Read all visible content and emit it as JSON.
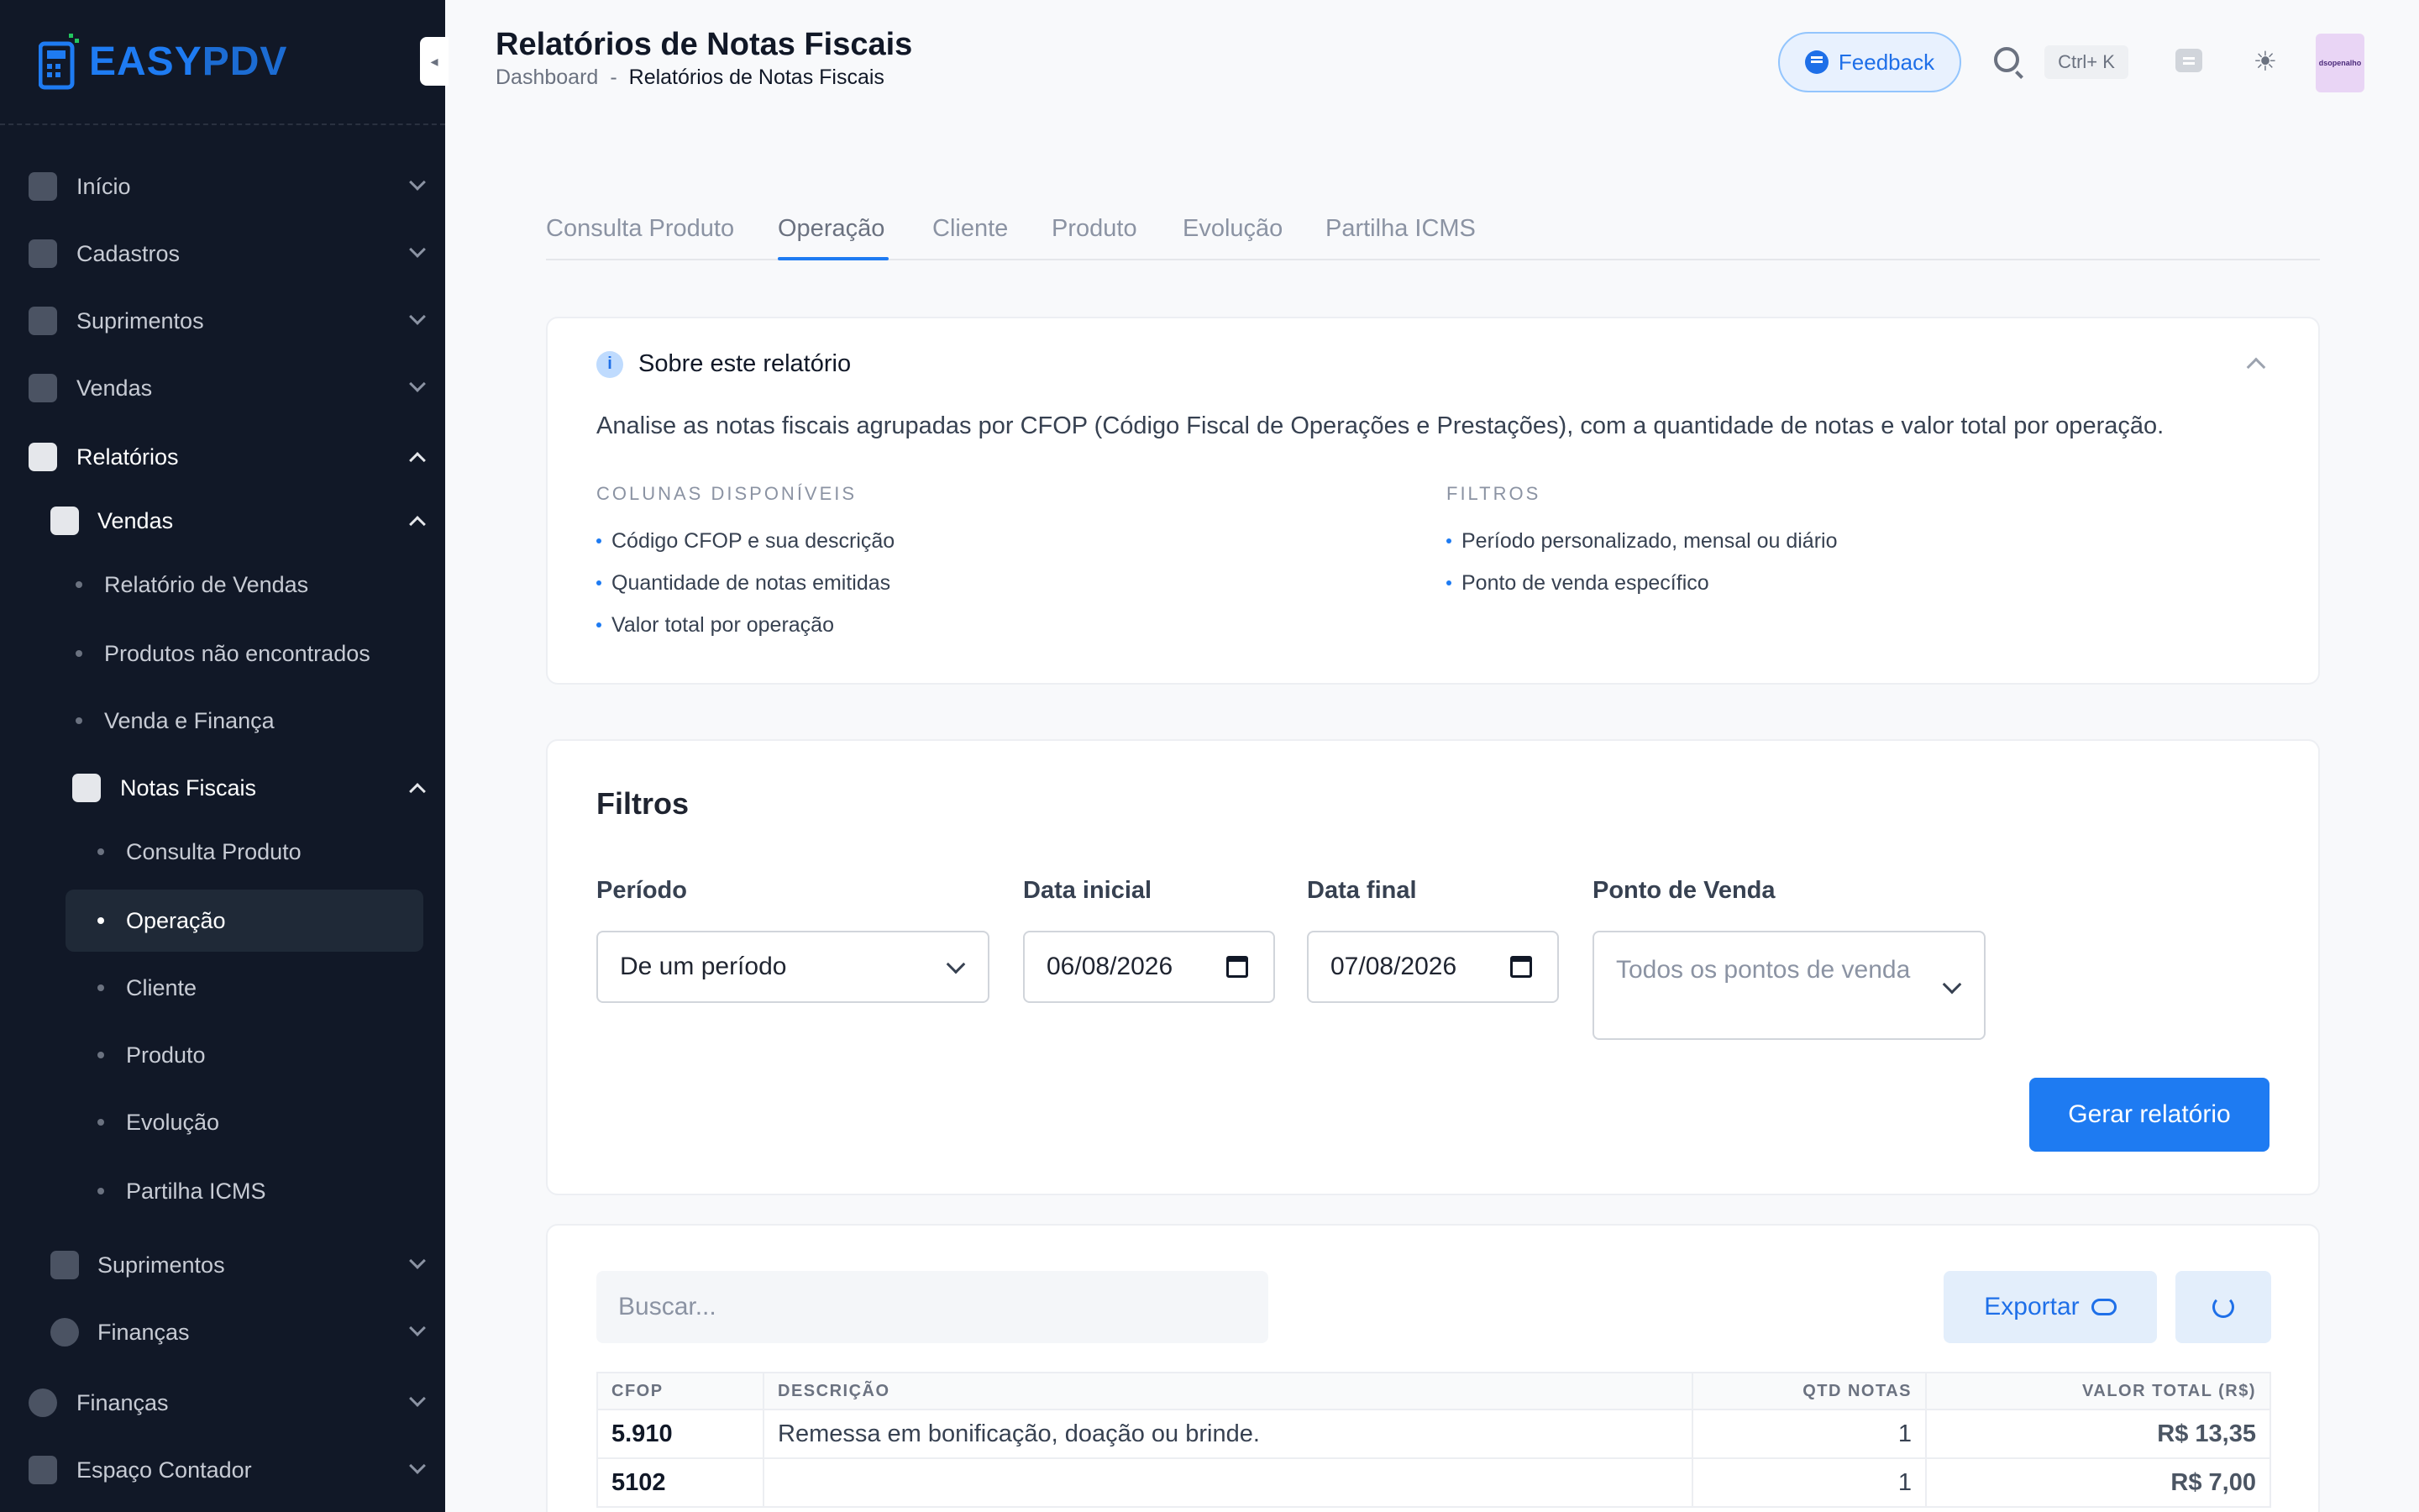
{
  "sidebar": {
    "logo": {
      "easy": "EASY",
      "pdv": "PDV"
    },
    "items": [
      {
        "label": "Início"
      },
      {
        "label": "Cadastros"
      },
      {
        "label": "Suprimentos"
      },
      {
        "label": "Vendas"
      },
      {
        "label": "Relatórios"
      },
      {
        "label": "Vendas"
      },
      {
        "label": "Relatório de Vendas"
      },
      {
        "label": "Produtos não encontrados"
      },
      {
        "label": "Venda e Finança"
      },
      {
        "label": "Notas Fiscais"
      },
      {
        "label": "Consulta Produto"
      },
      {
        "label": "Operação"
      },
      {
        "label": "Cliente"
      },
      {
        "label": "Produto"
      },
      {
        "label": "Evolução"
      },
      {
        "label": "Partilha ICMS"
      },
      {
        "label": "Suprimentos"
      },
      {
        "label": "Finanças"
      },
      {
        "label": "Finanças"
      },
      {
        "label": "Espaço Contador"
      }
    ]
  },
  "header": {
    "title": "Relatórios de Notas Fiscais",
    "breadcrumb": {
      "root": "Dashboard",
      "separator": "-",
      "current": "Relatórios de Notas Fiscais"
    },
    "feedback_label": "Feedback",
    "shortcut": "Ctrl+ K",
    "avatar_text": "dsopenalho"
  },
  "tabs": [
    "Consulta Produto",
    "Operação",
    "Cliente",
    "Produto",
    "Evolução",
    "Partilha ICMS"
  ],
  "about": {
    "title": "Sobre este relatório",
    "description": "Analise as notas fiscais agrupadas por CFOP (Código Fiscal de Operações e Prestações), com a quantidade de notas e valor total por operação.",
    "columns_title": "COLUNAS DISPONÍVEIS",
    "columns": [
      "Código CFOP e sua descrição",
      "Quantidade de notas emitidas",
      "Valor total por operação"
    ],
    "filters_title": "FILTROS",
    "filters": [
      "Período personalizado, mensal ou diário",
      "Ponto de venda específico"
    ]
  },
  "filters": {
    "title": "Filtros",
    "period_label": "Período",
    "period_value": "De um período",
    "start_label": "Data inicial",
    "start_value": "06/08/2026",
    "end_label": "Data final",
    "end_value": "07/08/2026",
    "pos_label": "Ponto de Venda",
    "pos_placeholder": "Todos os pontos de venda",
    "generate_label": "Gerar relatório"
  },
  "results": {
    "search_placeholder": "Buscar...",
    "export_label": "Exportar",
    "columns": [
      "CFOP",
      "DESCRIÇÃO",
      "QTD NOTAS",
      "VALOR TOTAL (R$)"
    ],
    "rows": [
      {
        "cfop": "5.910",
        "desc": "Remessa em bonificação, doação ou brinde.",
        "qtd": "1",
        "valor": "R$ 13,35"
      },
      {
        "cfop": "5102",
        "desc": "",
        "qtd": "1",
        "valor": "R$ 7,00"
      }
    ]
  },
  "colors": {
    "accent": "#1e7bf2",
    "sidebar_bg": "#111827"
  },
  "icons": [
    "logo-icon",
    "grid-icon",
    "id-card-icon",
    "box-icon",
    "calculator-icon",
    "chart-icon",
    "document-icon",
    "dollar-icon",
    "feedback-icon",
    "search-icon",
    "chat-icon",
    "sun-icon",
    "info-icon",
    "cloud-download-icon",
    "refresh-icon",
    "calendar-icon"
  ]
}
